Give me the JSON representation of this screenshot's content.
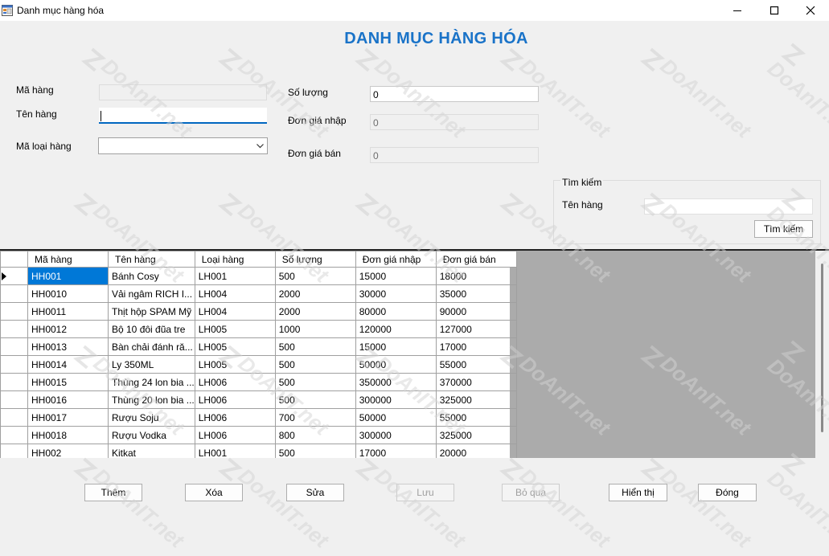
{
  "window": {
    "title": "Danh mục hàng hóa",
    "minimize_icon": "minimize-icon",
    "maximize_icon": "maximize-icon",
    "close_icon": "close-icon"
  },
  "heading": "DANH MỤC HÀNG HÓA",
  "form": {
    "ma_hang_label": "Mã hàng",
    "ma_hang_value": "",
    "ten_hang_label": "Tên hàng",
    "ten_hang_value": "",
    "ma_loai_hang_label": "Mã loại hàng",
    "ma_loai_hang_value": "",
    "so_luong_label": "Số lượng",
    "so_luong_value": "0",
    "don_gia_nhap_label": "Đơn giá nhập",
    "don_gia_nhap_value": "0",
    "don_gia_ban_label": "Đơn giá bán",
    "don_gia_ban_value": "0"
  },
  "search": {
    "group_title": "Tìm kiếm",
    "ten_hang_label": "Tên hàng",
    "ten_hang_value": "",
    "button_label": "Tìm kiếm"
  },
  "grid": {
    "columns": [
      "Mã hàng",
      "Tên hàng",
      "Loại hàng",
      "Số lượng",
      "Đơn giá nhập",
      "Đơn giá bán"
    ],
    "rows": [
      [
        "HH001",
        "Bánh Cosy",
        "LH001",
        "500",
        "15000",
        "18000"
      ],
      [
        "HH0010",
        "Vải ngâm RICH I...",
        "LH004",
        "2000",
        "30000",
        "35000"
      ],
      [
        "HH0011",
        "Thịt hộp SPAM Mỹ",
        "LH004",
        "2000",
        "80000",
        "90000"
      ],
      [
        "HH0012",
        "Bộ 10 đôi đũa tre",
        "LH005",
        "1000",
        "120000",
        "127000"
      ],
      [
        "HH0013",
        "Bàn chải đánh ră...",
        "LH005",
        "500",
        "15000",
        "17000"
      ],
      [
        "HH0014",
        "Ly 350ML",
        "LH005",
        "500",
        "50000",
        "55000"
      ],
      [
        "HH0015",
        "Thùng 24 lon bia ...",
        "LH006",
        "500",
        "350000",
        "370000"
      ],
      [
        "HH0016",
        "Thùng 20 lon bia ...",
        "LH006",
        "500",
        "300000",
        "325000"
      ],
      [
        "HH0017",
        "Rượu Soju",
        "LH006",
        "700",
        "50000",
        "55000"
      ],
      [
        "HH0018",
        "Rượu Vodka",
        "LH006",
        "800",
        "300000",
        "325000"
      ],
      [
        "HH002",
        "Kitkat",
        "LH001",
        "500",
        "17000",
        "20000"
      ]
    ],
    "selected_row": 0
  },
  "buttons": {
    "them": "Thêm",
    "xoa": "Xóa",
    "sua": "Sửa",
    "luu": "Lưu",
    "bo_qua": "Bỏ qua",
    "hien_thi": "Hiển thị",
    "dong": "Đóng"
  },
  "watermark": {
    "text": "DoAnIT.net"
  },
  "colors": {
    "heading": "#1a73c8",
    "selection": "#0078d7",
    "focus_underline": "#0067c0"
  }
}
